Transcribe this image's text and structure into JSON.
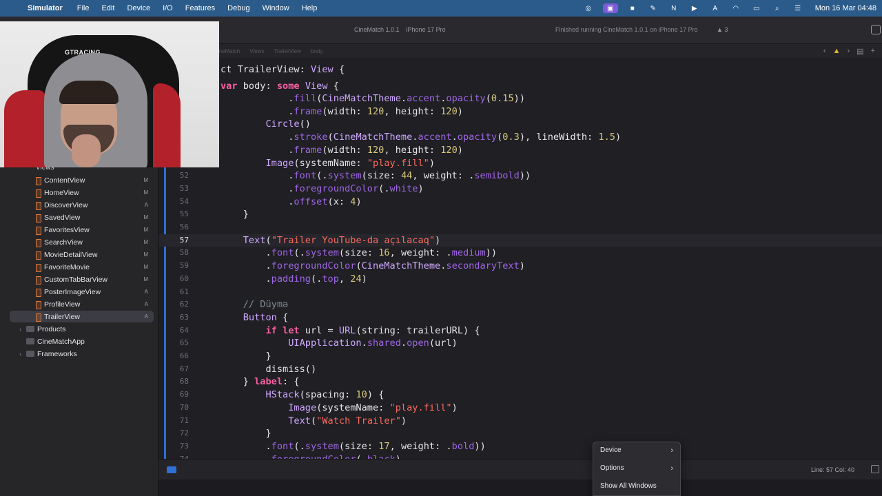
{
  "menubar": {
    "apple": "",
    "app_name": "Simulator",
    "items": [
      "File",
      "Edit",
      "Device",
      "I/O",
      "Features",
      "Debug",
      "Window",
      "Help"
    ],
    "clock": "Mon 16 Mar  04:48"
  },
  "toolbar": {
    "scheme": "CineMatch 1.0.1",
    "device": "iPhone 17 Pro",
    "status": "Finished running CineMatch 1.0.1 on iPhone 17 Pro",
    "warnings": "3"
  },
  "jumpbar": {
    "crumbs": [
      "CineMatch",
      "Views",
      "TrailerView",
      "body"
    ]
  },
  "webcam": {
    "chair_logo": "GTRACING"
  },
  "sidebar": {
    "group": "Views",
    "files": [
      {
        "name": "ContentView",
        "badge": "M"
      },
      {
        "name": "HomeView",
        "badge": "M"
      },
      {
        "name": "DiscoverView",
        "badge": "A"
      },
      {
        "name": "SavedView",
        "badge": "M"
      },
      {
        "name": "FavoritesView",
        "badge": "M"
      },
      {
        "name": "SearchView",
        "badge": "M"
      },
      {
        "name": "MovieDetailView",
        "badge": "M"
      },
      {
        "name": "FavoriteMovie",
        "badge": "M"
      },
      {
        "name": "CustomTabBarView",
        "badge": "M"
      },
      {
        "name": "PosterImageView",
        "badge": "A"
      },
      {
        "name": "ProfileView",
        "badge": "A"
      },
      {
        "name": "TrailerView",
        "badge": "A"
      }
    ],
    "folders": [
      {
        "name": "Products",
        "chevron": "›"
      },
      {
        "name": "CineMatchApp",
        "chevron": ""
      },
      {
        "name": "Frameworks",
        "chevron": "›"
      }
    ]
  },
  "editor": {
    "current_line": "57",
    "sticky_lines": [
      "ct TrailerView: View {",
      "var body: some View {"
    ],
    "lines": [
      {
        "n": "",
        "code": "            .fill(CineMatchTheme.accent.opacity(0.15))"
      },
      {
        "n": "",
        "code": "            .frame(width: 120, height: 120)"
      },
      {
        "n": "",
        "code": "        Circle()"
      },
      {
        "n": "",
        "code": "            .stroke(CineMatchTheme.accent.opacity(0.3), lineWidth: 1.5)"
      },
      {
        "n": "",
        "code": "            .frame(width: 120, height: 120)"
      },
      {
        "n": "",
        "code": "        Image(systemName: \"play.fill\")"
      },
      {
        "n": "52",
        "code": "            .font(.system(size: 44, weight: .semibold))"
      },
      {
        "n": "53",
        "code": "            .foregroundColor(.white)"
      },
      {
        "n": "54",
        "code": "            .offset(x: 4)"
      },
      {
        "n": "55",
        "code": "    }"
      },
      {
        "n": "56",
        "code": ""
      },
      {
        "n": "57",
        "code": "    Text(\"Trailer YouTube-da açılacaq\")"
      },
      {
        "n": "58",
        "code": "        .font(.system(size: 16, weight: .medium))"
      },
      {
        "n": "59",
        "code": "        .foregroundColor(CineMatchTheme.secondaryText)"
      },
      {
        "n": "60",
        "code": "        .padding(.top, 24)"
      },
      {
        "n": "61",
        "code": ""
      },
      {
        "n": "62",
        "code": "    // Düymə"
      },
      {
        "n": "63",
        "code": "    Button {"
      },
      {
        "n": "64",
        "code": "        if let url = URL(string: trailerURL) {"
      },
      {
        "n": "65",
        "code": "            UIApplication.shared.open(url)"
      },
      {
        "n": "66",
        "code": "        }"
      },
      {
        "n": "67",
        "code": "        dismiss()"
      },
      {
        "n": "68",
        "code": "    } label: {"
      },
      {
        "n": "69",
        "code": "        HStack(spacing: 10) {"
      },
      {
        "n": "70",
        "code": "            Image(systemName: \"play.fill\")"
      },
      {
        "n": "71",
        "code": "            Text(\"Watch Trailer\")"
      },
      {
        "n": "72",
        "code": "        }"
      },
      {
        "n": "73",
        "code": "        .font(.system(size: 17, weight: .bold))"
      },
      {
        "n": "74",
        "code": "        .foregroundColor(.black)"
      }
    ]
  },
  "debugbar": {
    "position": "Line: 57  Col: 40"
  },
  "context_menu": {
    "items": [
      {
        "label": "Device",
        "arrow": "›"
      },
      {
        "label": "Options",
        "arrow": "›"
      },
      {
        "label": "Show All Windows",
        "arrow": ""
      }
    ]
  },
  "colors": {
    "menubar": "#2b5b8a",
    "editor_bg": "#1f1f24",
    "keyword": "#fc5fa3",
    "string": "#fc6a5d",
    "number": "#d9c97c",
    "accent": "#2f6fd6"
  }
}
